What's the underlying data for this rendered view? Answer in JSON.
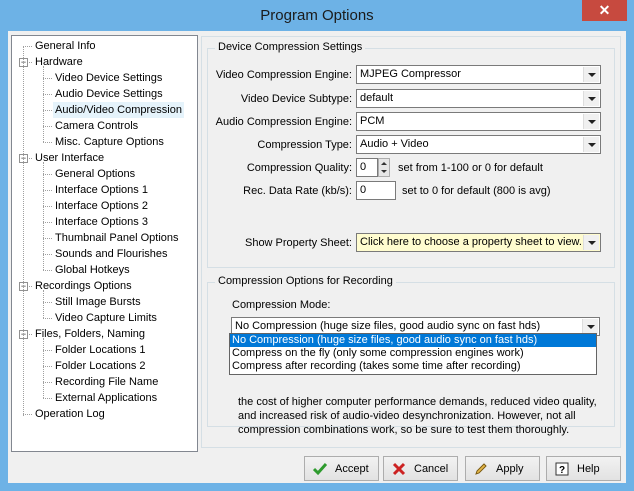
{
  "window": {
    "title": "Program Options",
    "close_glyph": "✕"
  },
  "tree": [
    {
      "label": "General Info",
      "level": 0
    },
    {
      "label": "Hardware",
      "level": 0,
      "expander": "−"
    },
    {
      "label": "Video Device Settings",
      "level": 1
    },
    {
      "label": "Audio Device Settings",
      "level": 1
    },
    {
      "label": "Audio/Video Compression",
      "level": 1,
      "selected": true
    },
    {
      "label": "Camera Controls",
      "level": 1
    },
    {
      "label": "Misc. Capture Options",
      "level": 1
    },
    {
      "label": "User Interface",
      "level": 0,
      "expander": "−"
    },
    {
      "label": "General Options",
      "level": 1
    },
    {
      "label": "Interface Options 1",
      "level": 1
    },
    {
      "label": "Interface Options 2",
      "level": 1
    },
    {
      "label": "Interface Options 3",
      "level": 1
    },
    {
      "label": "Thumbnail Panel Options",
      "level": 1
    },
    {
      "label": "Sounds and Flourishes",
      "level": 1
    },
    {
      "label": "Global Hotkeys",
      "level": 1
    },
    {
      "label": "Recordings Options",
      "level": 0,
      "expander": "−"
    },
    {
      "label": "Still Image Bursts",
      "level": 1
    },
    {
      "label": "Video Capture Limits",
      "level": 1
    },
    {
      "label": "Files, Folders, Naming",
      "level": 0,
      "expander": "−"
    },
    {
      "label": "Folder Locations 1",
      "level": 1
    },
    {
      "label": "Folder Locations 2",
      "level": 1
    },
    {
      "label": "Recording File Name",
      "level": 1
    },
    {
      "label": "External Applications",
      "level": 1
    },
    {
      "label": "Operation Log",
      "level": 0
    }
  ],
  "device_group": {
    "title": "Device Compression Settings",
    "video_engine_label": "Video Compression Engine:",
    "video_engine_value": "MJPEG Compressor",
    "subtype_label": "Video Device Subtype:",
    "subtype_value": "default",
    "audio_engine_label": "Audio Compression Engine:",
    "audio_engine_value": "PCM",
    "type_label": "Compression Type:",
    "type_value": "Audio + Video",
    "quality_label": "Compression Quality:",
    "quality_value": "0",
    "quality_hint": "set from 1-100 or 0 for default",
    "rate_label": "Rec. Data Rate (kb/s):",
    "rate_value": "0",
    "rate_hint": "set to 0 for default (800 is avg)",
    "sheet_label": "Show Property Sheet:",
    "sheet_value": "Click here to choose a property sheet to view..."
  },
  "recording_group": {
    "title": "Compression Options for Recording",
    "mode_label": "Compression Mode:",
    "mode_value": "No Compression (huge size files, good audio sync on fast hds)",
    "options": [
      "No Compression (huge size files, good audio sync on fast hds)",
      "Compress on the fly (only some compression engines work)",
      "Compress after recording (takes some time after recording)"
    ],
    "description_line1": "the cost of higher computer performance demands, reduced video quality,",
    "description_line2": "and increased risk of audio-video desynchronization.  However, not all",
    "description_line3": "compression combinations work, so be sure to test them thoroughly."
  },
  "buttons": {
    "accept": "Accept",
    "cancel": "Cancel",
    "apply": "Apply",
    "help": "Help"
  },
  "colors": {
    "title_bar": "#6db2e6",
    "close": "#c74a3f",
    "selection": "#0078d7",
    "accept_icon": "#2e9b2e",
    "cancel_icon": "#cc2222"
  }
}
